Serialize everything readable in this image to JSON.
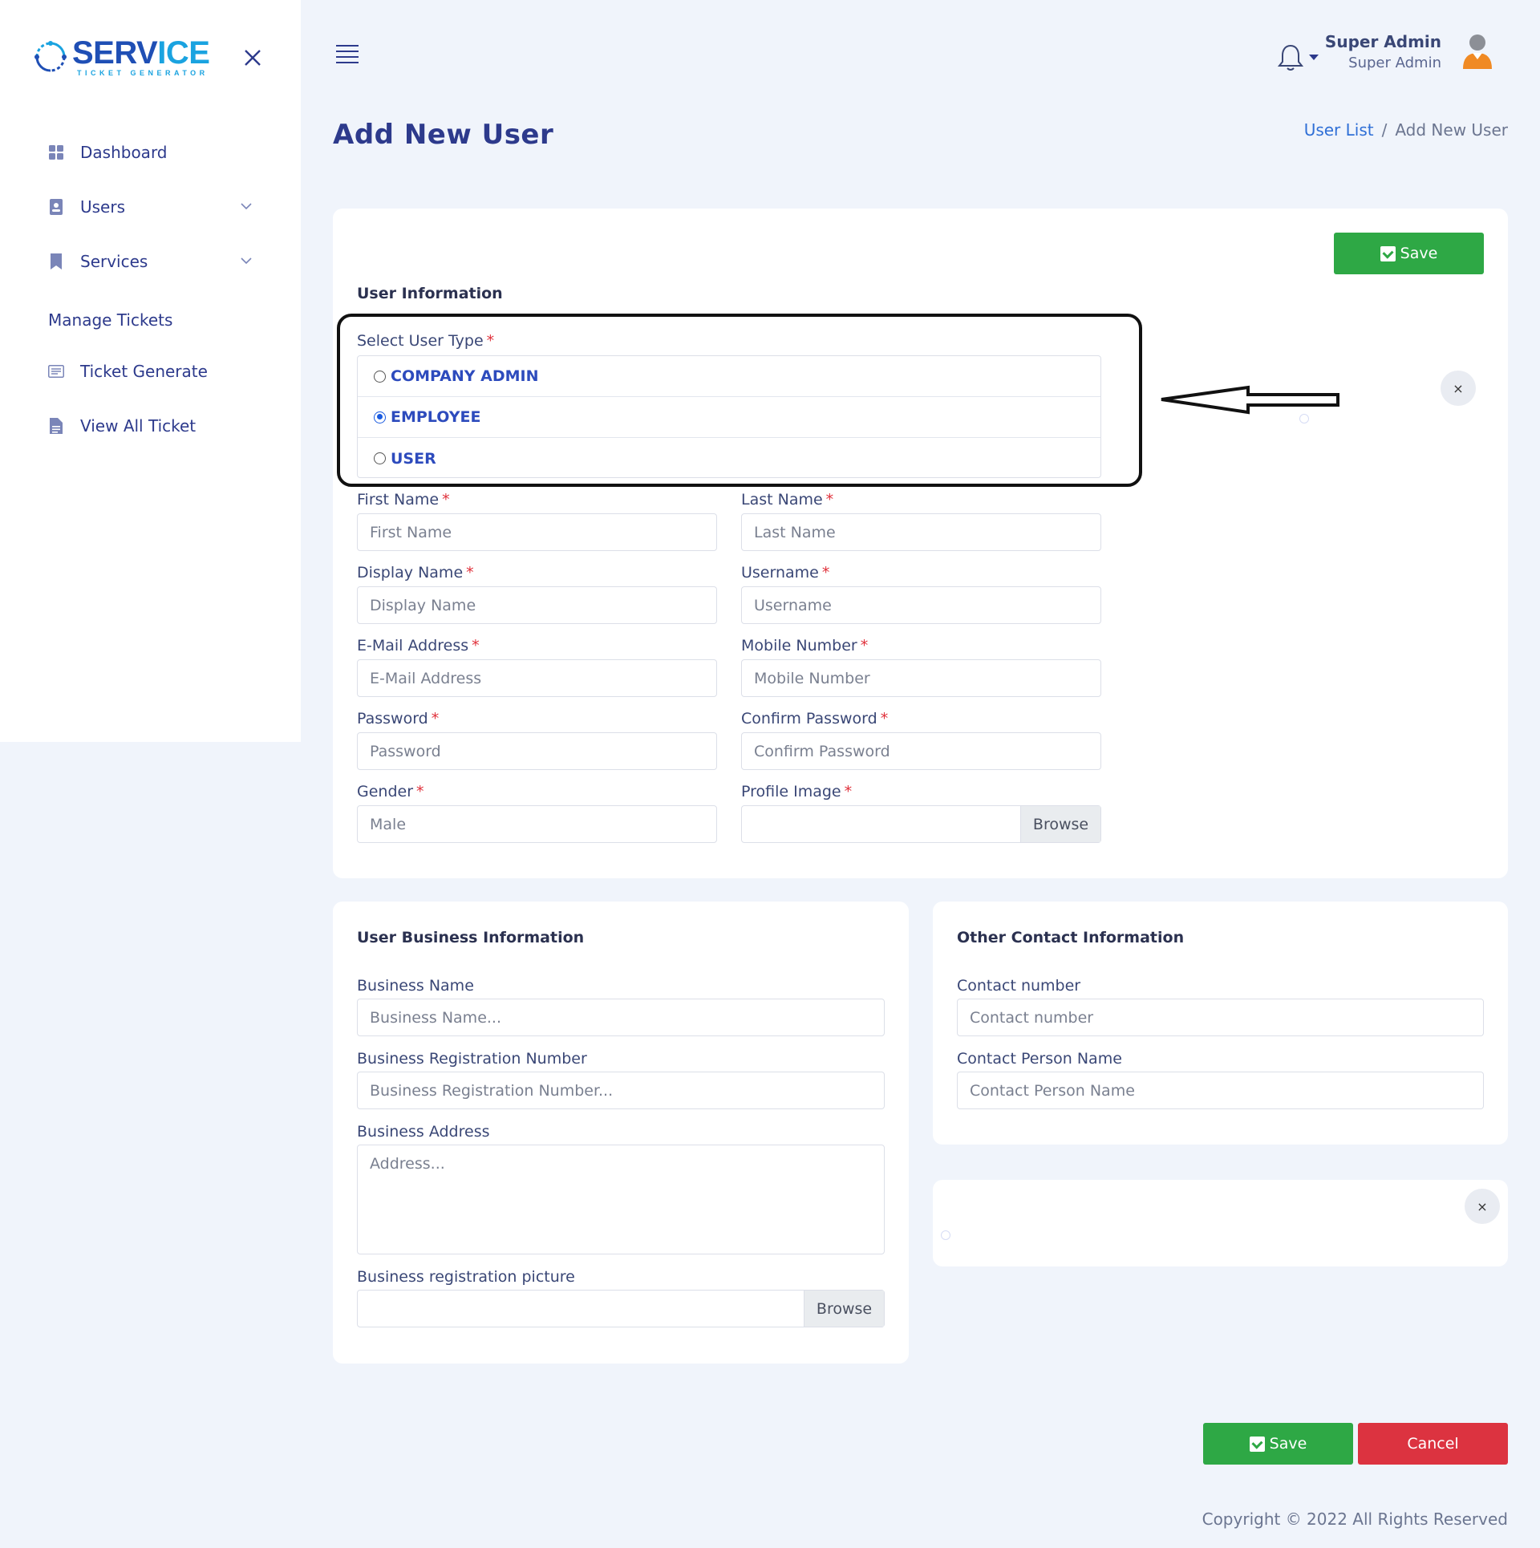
{
  "brand": {
    "title_main": "SERV",
    "title_accent": "ICE",
    "subtitle": "TICKET GENERATOR"
  },
  "sidebar": {
    "items": [
      {
        "label": "Dashboard",
        "icon": "grid-icon"
      },
      {
        "label": "Users",
        "icon": "user-badge-icon",
        "has_submenu": true
      },
      {
        "label": "Services",
        "icon": "bookmark-icon",
        "has_submenu": true
      }
    ],
    "section_title": "Manage Tickets",
    "section_items": [
      {
        "label": "Ticket Generate",
        "icon": "ticket-list-icon"
      },
      {
        "label": "View All Ticket",
        "icon": "document-icon"
      }
    ]
  },
  "header": {
    "user_name": "Super Admin",
    "user_role": "Super Admin"
  },
  "page": {
    "title": "Add New User",
    "breadcrumb": {
      "link": "User List",
      "separator": "/",
      "current": "Add New User"
    }
  },
  "user_info": {
    "save_label": "Save",
    "section_title": "User Information",
    "user_type_label": "Select User Type",
    "user_types": [
      {
        "label": "COMPANY ADMIN",
        "checked": false
      },
      {
        "label": "EMPLOYEE",
        "checked": true
      },
      {
        "label": "USER",
        "checked": false
      }
    ],
    "fields": {
      "first_name": {
        "label": "First Name",
        "placeholder": "First Name"
      },
      "last_name": {
        "label": "Last Name",
        "placeholder": "Last Name"
      },
      "display_name": {
        "label": "Display Name",
        "placeholder": "Display Name"
      },
      "username": {
        "label": "Username",
        "placeholder": "Username"
      },
      "email": {
        "label": "E-Mail Address",
        "placeholder": "E-Mail Address"
      },
      "mobile": {
        "label": "Mobile Number",
        "placeholder": "Mobile Number"
      },
      "password": {
        "label": "Password",
        "placeholder": "Password"
      },
      "confirm_password": {
        "label": "Confirm Password",
        "placeholder": "Confirm Password"
      },
      "gender": {
        "label": "Gender",
        "value": "Male"
      },
      "profile_image": {
        "label": "Profile Image",
        "button": "Browse"
      }
    },
    "required_mark": "*",
    "close_glyph": "×"
  },
  "business_info": {
    "section_title": "User Business Information",
    "business_name": {
      "label": "Business Name",
      "placeholder": "Business Name..."
    },
    "registration_number": {
      "label": "Business Registration Number",
      "placeholder": "Business Registration Number..."
    },
    "address": {
      "label": "Business Address",
      "placeholder": "Address..."
    },
    "registration_picture": {
      "label": "Business registration picture",
      "button": "Browse"
    }
  },
  "contact_info": {
    "section_title": "Other Contact Information",
    "contact_number": {
      "label": "Contact number",
      "placeholder": "Contact number"
    },
    "contact_person": {
      "label": "Contact Person Name",
      "placeholder": "Contact Person Name"
    }
  },
  "actions": {
    "save": "Save",
    "cancel": "Cancel"
  },
  "footer": {
    "copyright": "Copyright © 2022 All Rights Reserved"
  },
  "colors": {
    "primary": "#2d3a8c",
    "success": "#2ea845",
    "danger": "#dc3340",
    "background": "#f0f4fb"
  }
}
